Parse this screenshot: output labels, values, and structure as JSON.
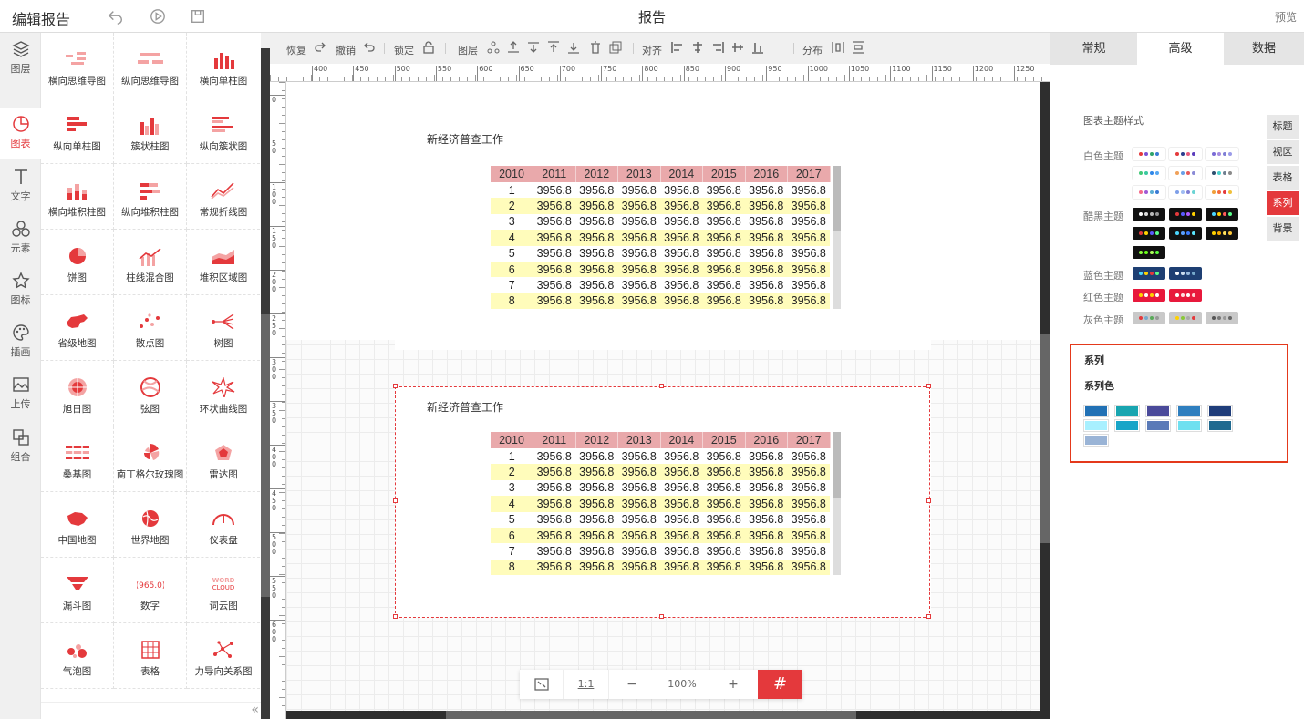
{
  "header": {
    "app_title": "编辑报告",
    "report_title": "报告",
    "preview": "预览",
    "icons": [
      "undo-icon",
      "play-icon",
      "save-icon"
    ]
  },
  "iconbar": [
    {
      "label": "图层",
      "icon": "layers-icon"
    },
    {
      "label": "图表",
      "icon": "chart-icon",
      "active": true
    },
    {
      "label": "文字",
      "icon": "text-icon"
    },
    {
      "label": "元素",
      "icon": "element-icon"
    },
    {
      "label": "图标",
      "icon": "star-icon"
    },
    {
      "label": "插画",
      "icon": "palette-icon"
    },
    {
      "label": "上传",
      "icon": "upload-image-icon"
    },
    {
      "label": "组合",
      "icon": "group-icon"
    }
  ],
  "charts": [
    "横向思维导图",
    "纵向思维导图",
    "横向单柱图",
    "纵向单柱图",
    "簇状柱图",
    "纵向簇状图",
    "横向堆积柱图",
    "纵向堆积柱图",
    "常规折线图",
    "饼图",
    "柱线混合图",
    "堆积区域图",
    "省级地图",
    "散点图",
    "树图",
    "旭日图",
    "弦图",
    "环状曲线图",
    "桑基图",
    "南丁格尔玫瑰图",
    "雷达图",
    "中国地图",
    "世界地图",
    "仪表盘",
    "漏斗图",
    "数字",
    "词云图",
    "气泡图",
    "表格",
    "力导向关系图"
  ],
  "toolbar": {
    "redo": "恢复",
    "undo": "撤销",
    "lock": "锁定",
    "layer": "图层",
    "align": "对齐",
    "distribute": "分布"
  },
  "ruler_labels": [
    "400",
    "450",
    "500",
    "550",
    "600",
    "650",
    "700",
    "750",
    "800",
    "850",
    "900",
    "950",
    "1000",
    "1050",
    "1100",
    "1150",
    "1200",
    "1250"
  ],
  "ruler_left_labels": [
    "0",
    "50",
    "100",
    "150",
    "200",
    "250",
    "300",
    "350",
    "400",
    "450",
    "500",
    "550",
    "600"
  ],
  "widgets": [
    {
      "title": "新经济普查工作"
    },
    {
      "title": "新经济普查工作"
    }
  ],
  "table": {
    "headers": [
      "2010",
      "2011",
      "2012",
      "2013",
      "2014",
      "2015",
      "2016",
      "2017"
    ],
    "rows": [
      [
        "1",
        "3956.8",
        "3956.8",
        "3956.8",
        "3956.8",
        "3956.8",
        "3956.8",
        "3956.8"
      ],
      [
        "2",
        "3956.8",
        "3956.8",
        "3956.8",
        "3956.8",
        "3956.8",
        "3956.8",
        "3956.8"
      ],
      [
        "3",
        "3956.8",
        "3956.8",
        "3956.8",
        "3956.8",
        "3956.8",
        "3956.8",
        "3956.8"
      ],
      [
        "4",
        "3956.8",
        "3956.8",
        "3956.8",
        "3956.8",
        "3956.8",
        "3956.8",
        "3956.8"
      ],
      [
        "5",
        "3956.8",
        "3956.8",
        "3956.8",
        "3956.8",
        "3956.8",
        "3956.8",
        "3956.8"
      ],
      [
        "6",
        "3956.8",
        "3956.8",
        "3956.8",
        "3956.8",
        "3956.8",
        "3956.8",
        "3956.8"
      ],
      [
        "7",
        "3956.8",
        "3956.8",
        "3956.8",
        "3956.8",
        "3956.8",
        "3956.8",
        "3956.8"
      ],
      [
        "8",
        "3956.8",
        "3956.8",
        "3956.8",
        "3956.8",
        "3956.8",
        "3956.8",
        "3956.8"
      ]
    ]
  },
  "zoom": {
    "ratio": "1:1",
    "minus": "−",
    "value": "100%",
    "plus": "+",
    "grid": "#"
  },
  "right_panel": {
    "tabs": [
      "常规",
      "高级",
      "数据"
    ],
    "active_tab": "高级",
    "theme_label": "图表主题样式",
    "themes": [
      {
        "name": "白色主题",
        "bg": "#fff",
        "sets": [
          [
            "#e4393c",
            "#7b52d6",
            "#2fa36a",
            "#3a7bd5"
          ],
          [
            "#e4393c",
            "#2c3e8f",
            "#e85a7b",
            "#5b3dbd"
          ],
          [
            "#7a6bd6",
            "#a58be0",
            "#7f7fd5",
            "#9b9be8"
          ],
          [
            "#42c977",
            "#3ac9a0",
            "#2f87e8",
            "#53a6f2"
          ],
          [
            "#f0a15a",
            "#6aa0e8",
            "#e85a5a",
            "#8a8ad6"
          ],
          [
            "#2f4f6f",
            "#48d1cc",
            "#708090",
            "#8a8a8a"
          ],
          [
            "#f56b8a",
            "#a05ad6",
            "#5aaed6",
            "#3a7bd5"
          ],
          [
            "#7e9fe8",
            "#9fbcf2",
            "#7f7fd5",
            "#6bd4d4"
          ],
          [
            "#f0a03a",
            "#f56b3a",
            "#e4393c",
            "#f0c03a"
          ]
        ]
      },
      {
        "name": "酷黑主题",
        "bg": "#111",
        "sets": [
          [
            "#fff",
            "#ddd",
            "#bbb",
            "#999"
          ],
          [
            "#e4393c",
            "#5a5aff",
            "#b05aff",
            "#ffd200"
          ],
          [
            "#4ad6ff",
            "#ffd200",
            "#ff5a5a",
            "#5aff8a"
          ],
          [
            "#e4393c",
            "#ffd200",
            "#5a5aff",
            "#5aff8a"
          ],
          [
            "#4ad6ff",
            "#5aa0ff",
            "#3a7bff",
            "#5ae8ff"
          ],
          [
            "#ffd200",
            "#ffb000",
            "#ffe05a",
            "#ffc83a"
          ],
          [
            "#8aff3a",
            "#6aff1a",
            "#aaff5a",
            "#5aff3a"
          ]
        ]
      },
      {
        "name": "蓝色主题",
        "bg": "#1e3f73",
        "sets": [
          [
            "#4ad6ff",
            "#ffd200",
            "#e4393c",
            "#5aff8a"
          ],
          [
            "#fff",
            "#cde",
            "#9bd",
            "#7ac"
          ]
        ]
      },
      {
        "name": "红色主题",
        "bg": "#e8193c",
        "sets": [
          [
            "#ffd200",
            "#fff",
            "#ffd200",
            "#fff"
          ],
          [
            "#fff",
            "#ffe0e0",
            "#fff",
            "#ffd0d0"
          ]
        ]
      },
      {
        "name": "灰色主题",
        "bg": "#c9c9c9",
        "sets": [
          [
            "#e4393c",
            "#7ac",
            "#5aaa5a",
            "#999"
          ],
          [
            "#ffd200",
            "#8ac83a",
            "#aaa",
            "#e4393c"
          ],
          [
            "#555",
            "#777",
            "#999",
            "#666"
          ]
        ]
      }
    ],
    "vtabs": [
      {
        "label": "标题"
      },
      {
        "label": "视区"
      },
      {
        "label": "表格"
      },
      {
        "label": "系列",
        "active": true
      },
      {
        "label": "背景"
      }
    ],
    "series": {
      "title": "系列",
      "color_label": "系列色",
      "colors": [
        "#2171b5",
        "#18a5b0",
        "#4a4a9a",
        "#2f7fbf",
        "#1f3d7a",
        "#a8f0ff",
        "#18a5c8",
        "#5a7ab8",
        "#6ee0f0",
        "#1f6a90",
        "#9ab4d6"
      ]
    }
  }
}
